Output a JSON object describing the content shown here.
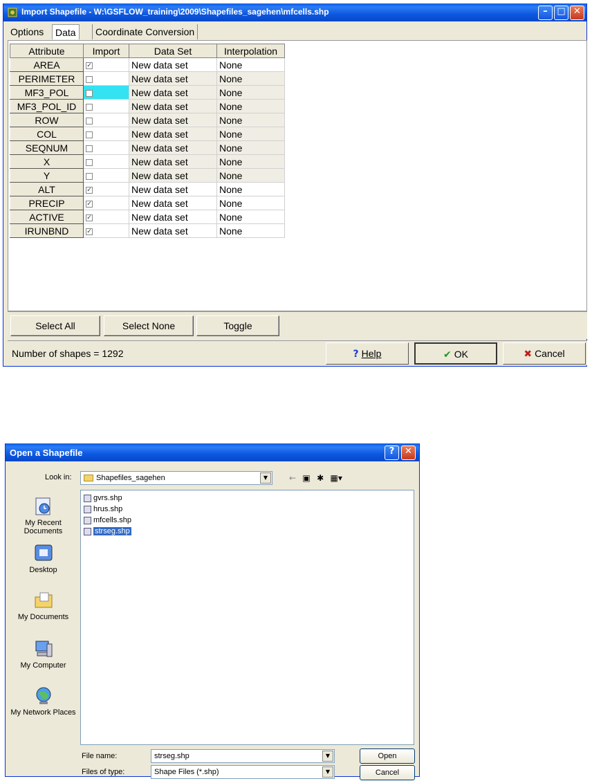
{
  "import_dialog": {
    "title": "Import Shapefile - W:\\GSFLOW_training\\2009\\Shapefiles_sagehen\\mfcells.shp",
    "tabs": [
      "Options",
      "Data",
      "Coordinate Conversion"
    ],
    "active_tab": "Data",
    "columns": [
      "Attribute",
      "Import",
      "Data Set",
      "Interpolation"
    ],
    "rows": [
      {
        "attribute": "AREA",
        "import": "✓",
        "data_set": "New data set",
        "interpolation": "None"
      },
      {
        "attribute": "PERIMETER",
        "import": "",
        "data_set": "New data set",
        "interpolation": "None"
      },
      {
        "attribute": "MF3_POL",
        "import": "",
        "data_set": "New data set",
        "interpolation": "None"
      },
      {
        "attribute": "MF3_POL_ID",
        "import": "",
        "data_set": "New data set",
        "interpolation": "None"
      },
      {
        "attribute": "ROW",
        "import": "",
        "data_set": "New data set",
        "interpolation": "None"
      },
      {
        "attribute": "COL",
        "import": "",
        "data_set": "New data set",
        "interpolation": "None"
      },
      {
        "attribute": "SEQNUM",
        "import": "",
        "data_set": "New data set",
        "interpolation": "None"
      },
      {
        "attribute": "X",
        "import": "",
        "data_set": "New data set",
        "interpolation": "None"
      },
      {
        "attribute": "Y",
        "import": "",
        "data_set": "New data set",
        "interpolation": "None"
      },
      {
        "attribute": "ALT",
        "import": "✓",
        "data_set": "New data set",
        "interpolation": "None"
      },
      {
        "attribute": "PRECIP",
        "import": "✓",
        "data_set": "New data set",
        "interpolation": "None"
      },
      {
        "attribute": "ACTIVE",
        "import": "✓",
        "data_set": "New data set",
        "interpolation": "None"
      },
      {
        "attribute": "IRUNBND",
        "import": "✓",
        "data_set": "New data set",
        "interpolation": "None"
      }
    ],
    "buttons": {
      "select_all": "Select All",
      "select_none": "Select None",
      "toggle": "Toggle"
    },
    "status": "Number of shapes = 1292",
    "help": "Help",
    "ok": "OK",
    "cancel": "Cancel",
    "colors": {
      "focus_cell": "#33e3f2",
      "ok_check": "#1a9a1a",
      "cancel_x": "#c0201a"
    }
  },
  "open_dialog": {
    "title": "Open a Shapefile",
    "look_in_label": "Look in:",
    "look_in_value": "Shapefiles_sagehen",
    "places": [
      "My Recent Documents",
      "Desktop",
      "My Documents",
      "My Computer",
      "My Network Places"
    ],
    "files": [
      "gvrs.shp",
      "hrus.shp",
      "mfcells.shp",
      "strseg.shp"
    ],
    "selected_file": "strseg.shp",
    "file_name_label": "File name:",
    "file_name_value": "strseg.shp",
    "file_type_label": "Files of type:",
    "file_type_value": "Shape Files (*.shp)",
    "open": "Open",
    "cancel": "Cancel",
    "colors": {
      "selection": "#316ac5"
    }
  }
}
